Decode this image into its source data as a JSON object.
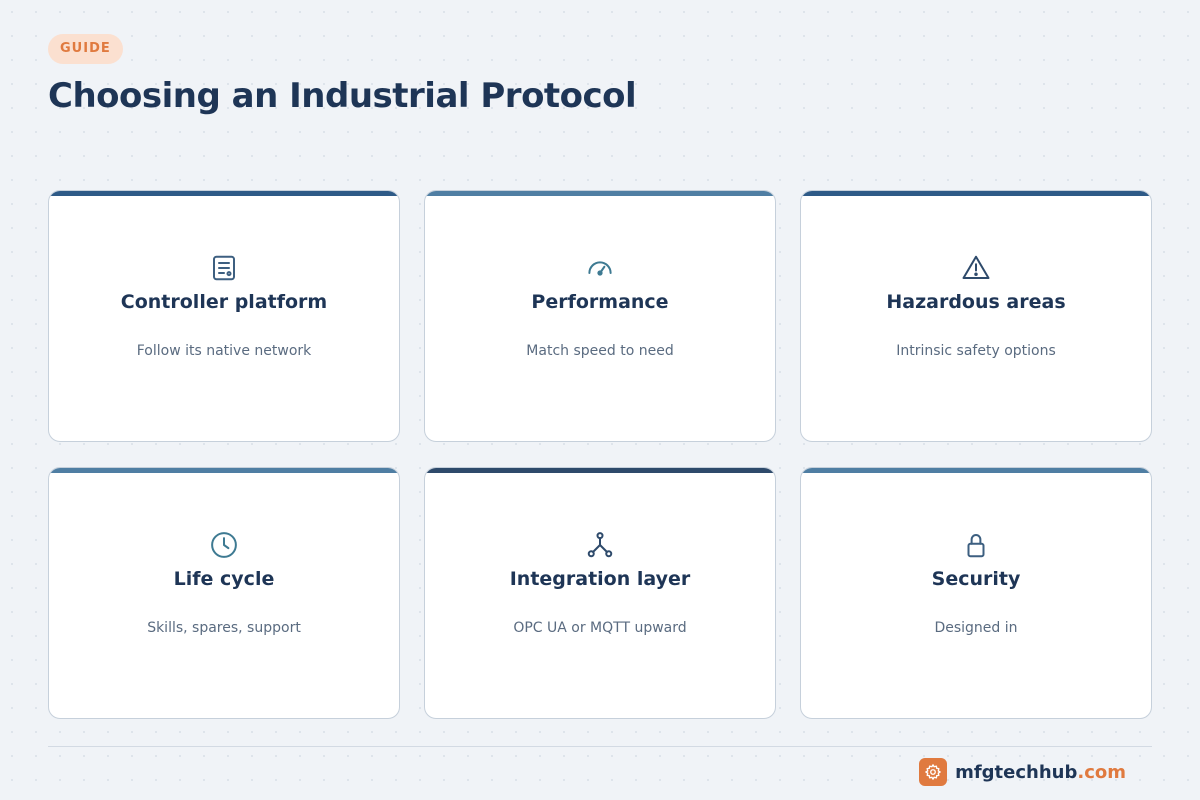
{
  "header": {
    "badge": "GUIDE",
    "title": "Choosing an Industrial Protocol"
  },
  "colors": {
    "accent": "#e07a3f",
    "navy": "#1e3556",
    "bar_dark": "#2e5a87",
    "bar_light": "#4f7ea3",
    "icon_slate": "#3d5f80",
    "icon_teal": "#3e7a92"
  },
  "cards": [
    {
      "title": "Controller platform",
      "description": "Follow its native network",
      "icon": "controller-icon"
    },
    {
      "title": "Performance",
      "description": "Match speed to need",
      "icon": "gauge-icon"
    },
    {
      "title": "Hazardous areas",
      "description": "Intrinsic safety options",
      "icon": "warning-icon"
    },
    {
      "title": "Life cycle",
      "description": "Skills, spares, support",
      "icon": "clock-icon"
    },
    {
      "title": "Integration layer",
      "description": "OPC UA or MQTT upward",
      "icon": "network-icon"
    },
    {
      "title": "Security",
      "description": "Designed in",
      "icon": "lock-icon"
    }
  ],
  "footer": {
    "brand_name": "mfgtechhub",
    "brand_tld": ".com",
    "logo_icon": "gear-icon"
  }
}
